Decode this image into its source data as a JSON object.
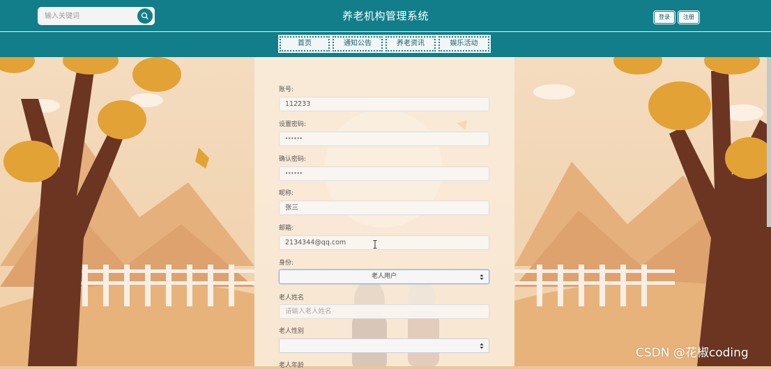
{
  "header": {
    "search_placeholder": "输入关键词",
    "site_title": "养老机构管理系统",
    "login_label": "登录",
    "register_label": "注册"
  },
  "nav": {
    "items": [
      {
        "label": "首页"
      },
      {
        "label": "通知公告"
      },
      {
        "label": "养老资讯"
      },
      {
        "label": "娱乐活动"
      }
    ]
  },
  "form": {
    "account": {
      "label": "账号:",
      "value": "112233"
    },
    "password": {
      "label": "设置密码:",
      "value": "••••••"
    },
    "confirm_password": {
      "label": "确认密码:",
      "value": "••••••"
    },
    "nickname": {
      "label": "昵称:",
      "value": "张三"
    },
    "email": {
      "label": "邮箱:",
      "value": "2134344@qq.com"
    },
    "identity": {
      "label": "身份:",
      "value": "老人用户"
    },
    "elder_name": {
      "label": "老人姓名",
      "placeholder": "请输入老人姓名"
    },
    "elder_gender": {
      "label": "老人性别",
      "value": ""
    },
    "elder_age": {
      "label": "老人年龄"
    }
  },
  "watermark": "CSDN @花椒coding",
  "colors": {
    "header_bg": "#117e89",
    "page_bg": "#e9c79d",
    "select_focus": "#86aee0"
  }
}
